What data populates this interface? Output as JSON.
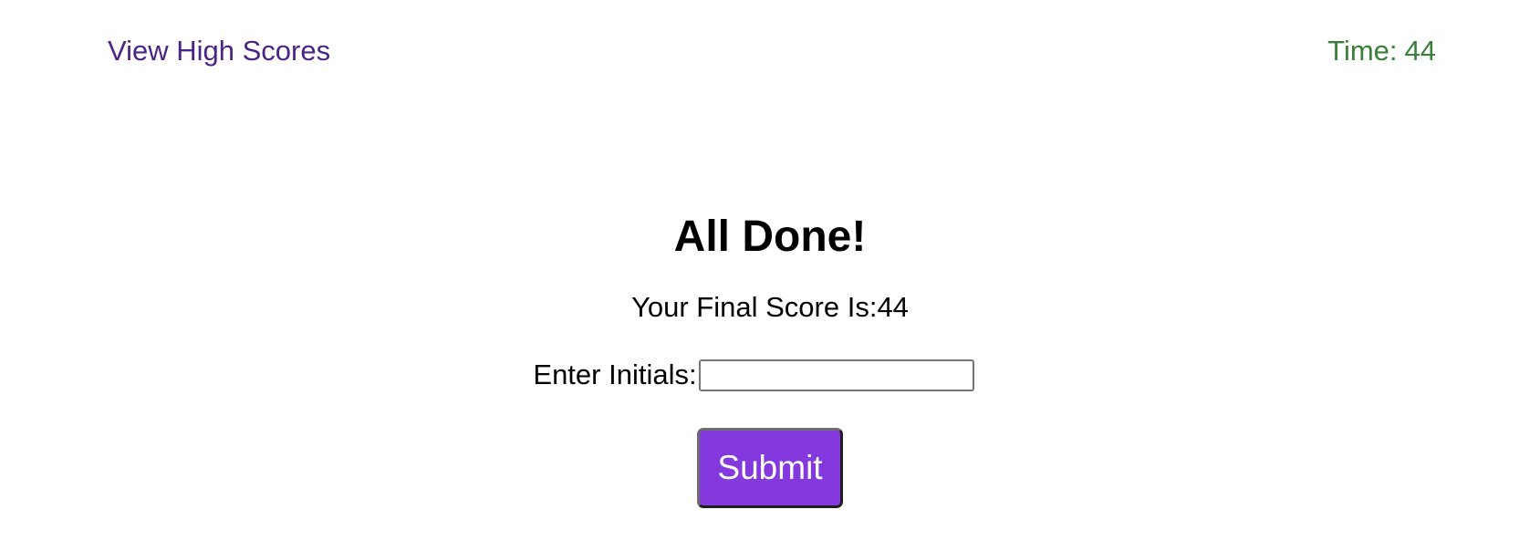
{
  "header": {
    "high_scores_label": "View High Scores",
    "timer_label": "Time:",
    "timer_value": "44"
  },
  "result": {
    "title": "All Done!",
    "final_score_label": "Your Final Score Is:",
    "final_score_value": "44",
    "initials_label": "Enter Initials:",
    "initials_value": "",
    "submit_label": "Submit"
  },
  "colors": {
    "link": "#4b2585",
    "timer": "#3a7f3a",
    "button_bg": "#8339de",
    "button_text": "#ffffff"
  }
}
